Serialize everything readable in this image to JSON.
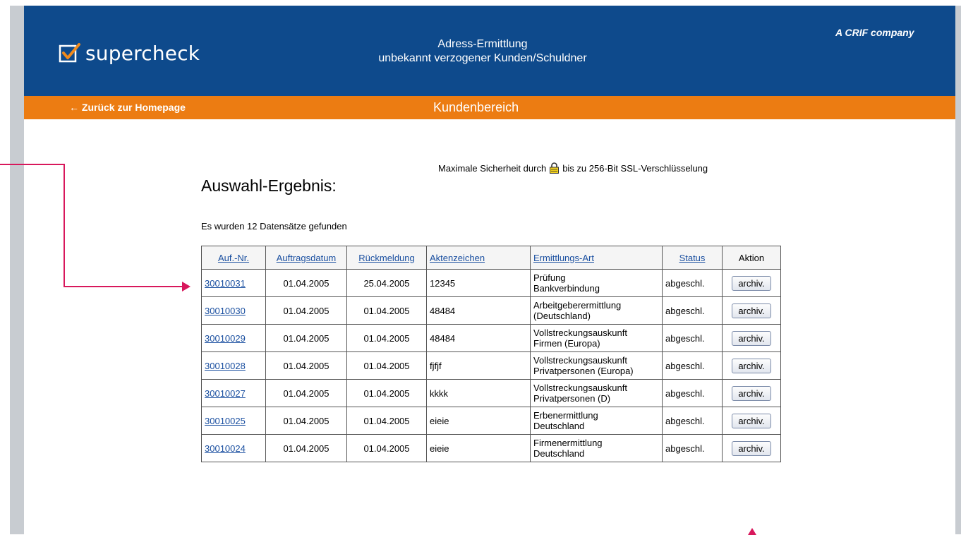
{
  "header": {
    "brand": "supercheck",
    "title_line1": "Adress-Ermittlung",
    "title_line2": "unbekannt verzogener Kunden/Schuldner",
    "crif": "A CRIF company"
  },
  "nav": {
    "back_link": "← Zurück zur Homepage",
    "section": "Kundenbereich"
  },
  "security": {
    "text_before": "Maximale Sicherheit durch",
    "text_after": "bis zu 256-Bit SSL-Verschlüsselung"
  },
  "main": {
    "heading": "Auswahl-Ergebnis:",
    "count_text": "Es wurden 12 Datensätze gefunden"
  },
  "table": {
    "headers": [
      "Auf.-Nr.",
      "Auftragsdatum",
      "Rückmeldung",
      "Aktenzeichen",
      "Ermittlungs-Art",
      "Status",
      "Aktion"
    ],
    "rows": [
      {
        "nr": "30010031",
        "datum": "01.04.2005",
        "rueck": "25.04.2005",
        "akten": "12345",
        "art1": "Prüfung",
        "art2": "Bankverbindung",
        "status": "abgeschl.",
        "aktion": "archiv."
      },
      {
        "nr": "30010030",
        "datum": "01.04.2005",
        "rueck": "01.04.2005",
        "akten": "48484",
        "art1": "Arbeitgeberermittlung",
        "art2": "(Deutschland)",
        "status": "abgeschl.",
        "aktion": "archiv."
      },
      {
        "nr": "30010029",
        "datum": "01.04.2005",
        "rueck": "01.04.2005",
        "akten": "48484",
        "art1": "Vollstreckungsauskunft",
        "art2": "Firmen (Europa)",
        "status": "abgeschl.",
        "aktion": "archiv."
      },
      {
        "nr": "30010028",
        "datum": "01.04.2005",
        "rueck": "01.04.2005",
        "akten": "fjfjf",
        "art1": "Vollstreckungsauskunft",
        "art2": "Privatpersonen (Europa)",
        "status": "abgeschl.",
        "aktion": "archiv."
      },
      {
        "nr": "30010027",
        "datum": "01.04.2005",
        "rueck": "01.04.2005",
        "akten": "kkkk",
        "art1": "Vollstreckungsauskunft",
        "art2": "Privatpersonen (D)",
        "status": "abgeschl.",
        "aktion": "archiv."
      },
      {
        "nr": "30010025",
        "datum": "01.04.2005",
        "rueck": "01.04.2005",
        "akten": "eieie",
        "art1": "Erbenermittlung",
        "art2": "Deutschland",
        "status": "abgeschl.",
        "aktion": "archiv."
      },
      {
        "nr": "30010024",
        "datum": "01.04.2005",
        "rueck": "01.04.2005",
        "akten": "eieie",
        "art1": "Firmenermittlung",
        "art2": "Deutschland",
        "status": "abgeschl.",
        "aktion": "archiv."
      }
    ]
  },
  "colors": {
    "header_blue": "#0e4a8c",
    "nav_orange": "#ec7c12",
    "annotation_pink": "#d8185c",
    "link_blue": "#1a4fa0"
  },
  "icons": [
    "check-box-icon",
    "lock-icon"
  ]
}
